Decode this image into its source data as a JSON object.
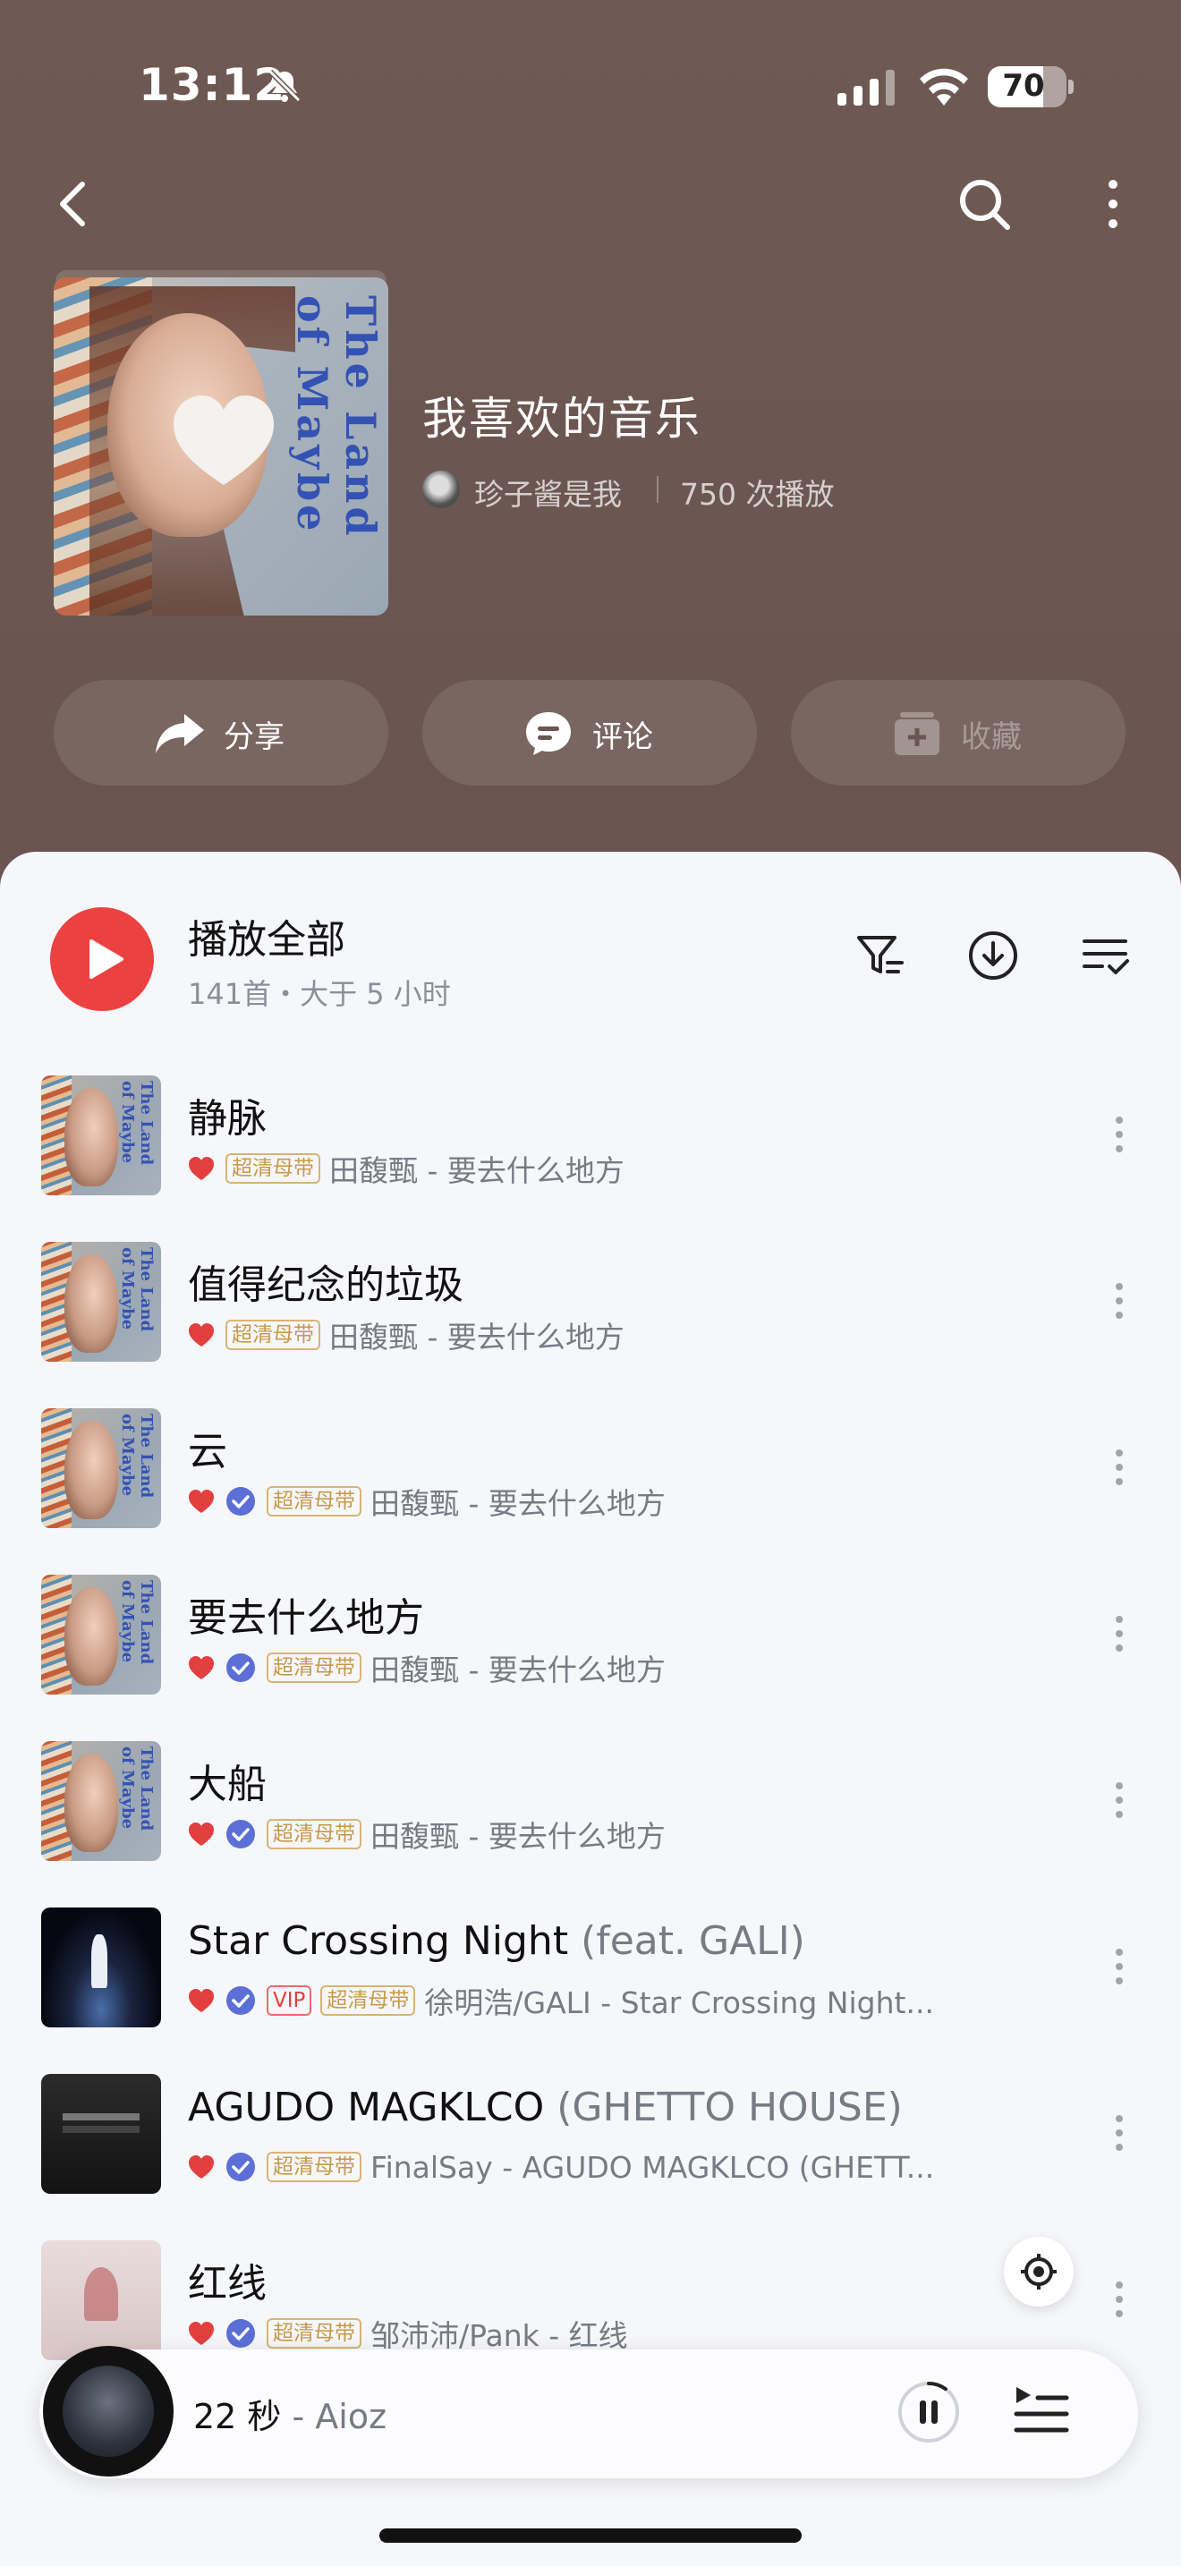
{
  "status_bar": {
    "time": "13:12",
    "battery": "70",
    "battery_level": 0.7
  },
  "nav": {
    "back_icon": "chevron-left-icon",
    "search_icon": "search-icon",
    "more_icon": "more-vertical-icon"
  },
  "playlist": {
    "title": "我喜欢的音乐",
    "creator": "珍子酱是我",
    "play_count": "750 次播放",
    "cover_art_text": "The Land of Maybe"
  },
  "actions": {
    "share": "分享",
    "comment": "评论",
    "collect": "收藏"
  },
  "play_all": {
    "label": "播放全部",
    "summary": "141首・大于 5 小时"
  },
  "tracks": [
    {
      "title": "静脉",
      "feat": "",
      "badges": [
        "超清母带"
      ],
      "verified": false,
      "artist": "田馥甄 - 要去什么地方",
      "cover": "album"
    },
    {
      "title": "值得纪念的垃圾",
      "feat": "",
      "badges": [
        "超清母带"
      ],
      "verified": false,
      "artist": "田馥甄 - 要去什么地方",
      "cover": "album"
    },
    {
      "title": "云",
      "feat": "",
      "badges": [
        "超清母带"
      ],
      "verified": true,
      "artist": "田馥甄 - 要去什么地方",
      "cover": "album"
    },
    {
      "title": "要去什么地方",
      "feat": "",
      "badges": [
        "超清母带"
      ],
      "verified": true,
      "artist": "田馥甄 - 要去什么地方",
      "cover": "album"
    },
    {
      "title": "大船",
      "feat": "",
      "badges": [
        "超清母带"
      ],
      "verified": true,
      "artist": "田馥甄 - 要去什么地方",
      "cover": "album"
    },
    {
      "title": "Star Crossing Night",
      "feat": " (feat. GALI)",
      "badges": [
        "VIP",
        "超清母带"
      ],
      "verified": true,
      "artist": "徐明浩/GALI - Star Crossing Night...",
      "cover": "night"
    },
    {
      "title": "AGUDO MAGKLCO",
      "feat": " (GHETTO HOUSE)",
      "badges": [
        "超清母带"
      ],
      "verified": true,
      "artist": "FinalSay - AGUDO MAGKLCO (GHETT...",
      "cover": "dark"
    },
    {
      "title": "红线",
      "feat": "",
      "badges": [
        "超清母带"
      ],
      "verified": true,
      "artist": "邹沛沛/Pank - 红线",
      "cover": "pink"
    }
  ],
  "mini_player": {
    "title": "22 秒",
    "artist": " - Aioz",
    "progress": 0.1
  },
  "colors": {
    "header_bg": "#6b5550",
    "accent_red": "#ec4141",
    "hq_badge": "#c79a4a",
    "vip_badge": "#e33f3f",
    "verified_blue": "#5b6fd6"
  }
}
